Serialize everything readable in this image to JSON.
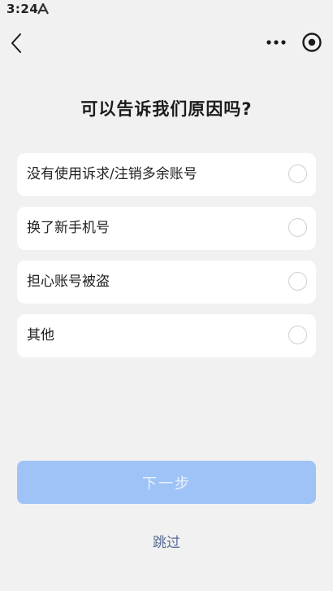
{
  "status_bar": {
    "time": "3:24",
    "app_icon": "a-notification-icon"
  },
  "nav": {
    "back_icon": "chevron-left-icon",
    "more_icon": "more-dots-icon",
    "target_icon": "target-icon"
  },
  "title": "可以告诉我们原因吗?",
  "options": [
    {
      "label": "没有使用诉求/注销多余账号",
      "selected": false
    },
    {
      "label": "换了新手机号",
      "selected": false
    },
    {
      "label": "担心账号被盗",
      "selected": false
    },
    {
      "label": "其他",
      "selected": false
    }
  ],
  "next_button": {
    "label": "下一步",
    "enabled": false,
    "color": "#9fc3f7"
  },
  "skip_label": "跳过",
  "colors": {
    "background": "#f1f1f1",
    "card": "#ffffff",
    "link": "#576b95"
  }
}
